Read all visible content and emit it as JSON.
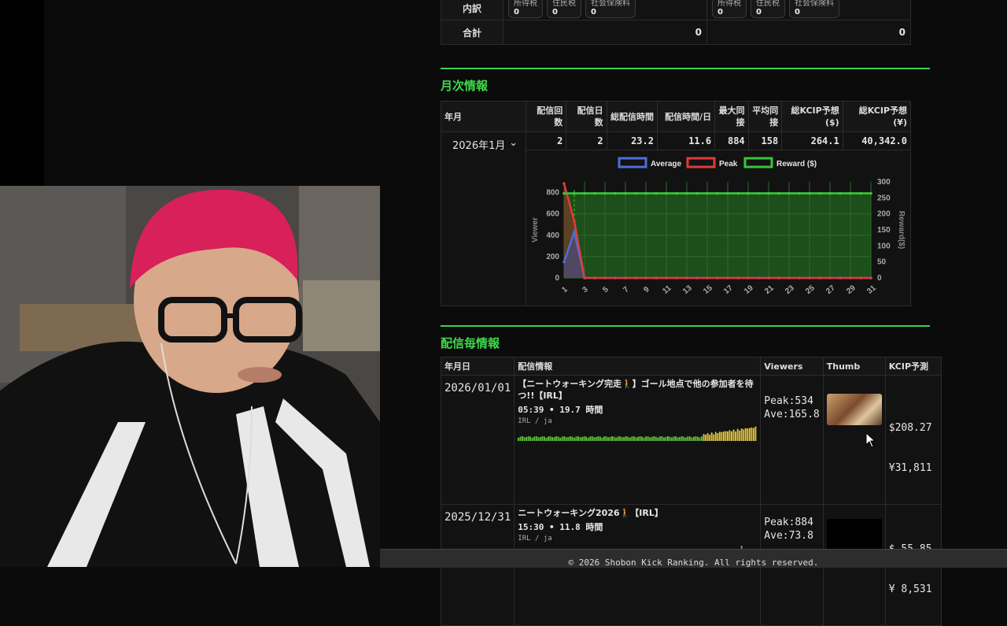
{
  "summary": {
    "breakdown_label": "内訳",
    "total_label": "合計",
    "left": {
      "chips": [
        {
          "label": "所得税",
          "value": "0"
        },
        {
          "label": "住民税",
          "value": "0"
        },
        {
          "label": "社会保険料",
          "value": "0"
        }
      ],
      "total": "0"
    },
    "right": {
      "chips": [
        {
          "label": "所得税",
          "value": "0"
        },
        {
          "label": "住民税",
          "value": "0"
        },
        {
          "label": "社会保険料",
          "value": "0"
        }
      ],
      "total": "0"
    }
  },
  "monthly": {
    "title": "月次情報",
    "headers": [
      "年月",
      "配信回数",
      "配信日数",
      "総配信時間",
      "配信時間/日",
      "最大同接",
      "平均同接",
      "総KCIP予想($)",
      "総KCIP予想(¥)"
    ],
    "selected_month": "2026年1月",
    "row": [
      "2",
      "2",
      "23.2",
      "11.6",
      "884",
      "158",
      "264.1",
      "40,342.0"
    ]
  },
  "chart_data": {
    "type": "line",
    "legend": [
      "Average",
      "Peak",
      "Reward ($)"
    ],
    "ylabel": "Viewer",
    "y2label": "Reward($)",
    "x": [
      1,
      2,
      3,
      4,
      5,
      6,
      7,
      8,
      9,
      10,
      11,
      12,
      13,
      14,
      15,
      16,
      17,
      18,
      19,
      20,
      21,
      22,
      23,
      24,
      25,
      26,
      27,
      28,
      29,
      30,
      31
    ],
    "xticks": [
      "1",
      "3",
      "5",
      "7",
      "9",
      "11",
      "13",
      "15",
      "17",
      "19",
      "21",
      "23",
      "25",
      "27",
      "29",
      "31"
    ],
    "yticks": [
      "0",
      "200",
      "400",
      "600",
      "800"
    ],
    "y2ticks": [
      "0",
      "50",
      "100",
      "150",
      "200",
      "250",
      "300"
    ],
    "ylim": [
      0,
      900
    ],
    "y2lim": [
      0,
      300
    ],
    "series": [
      {
        "name": "Average",
        "color": "#4f6ddb",
        "values": [
          150,
          430,
          0,
          0,
          0,
          0,
          0,
          0,
          0,
          0,
          0,
          0,
          0,
          0,
          0,
          0,
          0,
          0,
          0,
          0,
          0,
          0,
          0,
          0,
          0,
          0,
          0,
          0,
          0,
          0,
          0
        ]
      },
      {
        "name": "Peak",
        "color": "#e03b3b",
        "values": [
          884,
          534,
          0,
          0,
          0,
          0,
          0,
          0,
          0,
          0,
          0,
          0,
          0,
          0,
          0,
          0,
          0,
          0,
          0,
          0,
          0,
          0,
          0,
          0,
          0,
          0,
          0,
          0,
          0,
          0,
          0
        ]
      },
      {
        "name": "Reward ($)",
        "color": "#39c43a",
        "axis": "right",
        "values": [
          264.1,
          264.1,
          264.1,
          264.1,
          264.1,
          264.1,
          264.1,
          264.1,
          264.1,
          264.1,
          264.1,
          264.1,
          264.1,
          264.1,
          264.1,
          264.1,
          264.1,
          264.1,
          264.1,
          264.1,
          264.1,
          264.1,
          264.1,
          264.1,
          264.1,
          264.1,
          264.1,
          264.1,
          264.1,
          264.1,
          264.1
        ]
      }
    ]
  },
  "streams": {
    "title": "配信毎情報",
    "headers": [
      "年月日",
      "配信情報",
      "Viewers",
      "Thumb",
      "KCIP予測"
    ],
    "rows": [
      {
        "date": "2026/01/01",
        "title": "【ニートウォーキング完走🚶】ゴール地点で他の参加者を待つ!!【IRL】",
        "meta": "05:39 • 19.7 時間",
        "sub": "IRL / ja",
        "peak": "Peak:534",
        "ave": "Ave:165.8",
        "usd": "$208.27",
        "jpy": "¥31,811"
      },
      {
        "date": "2025/12/31",
        "title": "ニートウォーキング2026🚶【IRL】",
        "meta": "15:30 • 11.8 時間",
        "sub": "IRL / ja",
        "peak": "Peak:884",
        "ave": "Ave:73.8",
        "usd": "$ 55.85",
        "jpy": "¥ 8,531"
      }
    ]
  },
  "footer": "© 2026 Shobon Kick Ranking. All rights reserved."
}
